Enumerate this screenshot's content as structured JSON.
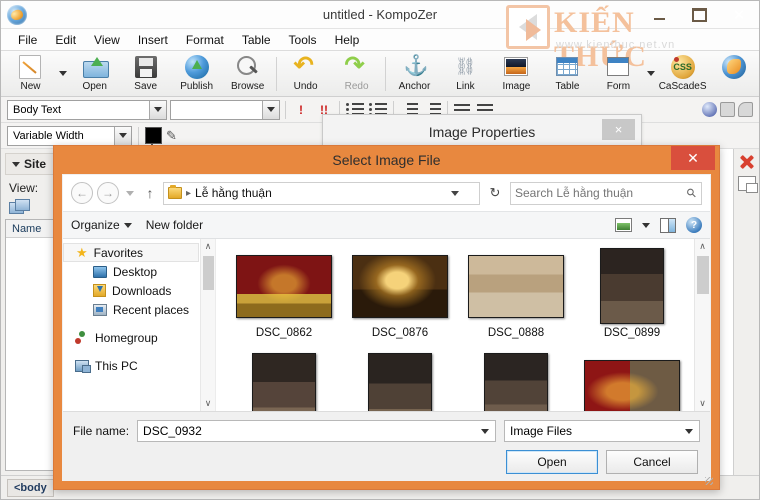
{
  "app": {
    "title": "untitled - KompoZer",
    "icon": "kompozer-globe-icon",
    "window_controls": {
      "minimize": "–",
      "maximize": "□",
      "close": "✕"
    }
  },
  "watermark": {
    "brand": "KIẾN THỨC",
    "url": "www.kienthuc.net.vn"
  },
  "menubar": [
    {
      "label": "File"
    },
    {
      "label": "Edit"
    },
    {
      "label": "View"
    },
    {
      "label": "Insert"
    },
    {
      "label": "Format"
    },
    {
      "label": "Table"
    },
    {
      "label": "Tools"
    },
    {
      "label": "Help"
    }
  ],
  "toolbar": [
    {
      "label": "New",
      "icon": "new-document-icon",
      "has_caret": true
    },
    {
      "label": "Open",
      "icon": "open-folder-icon",
      "has_caret": false
    },
    {
      "label": "Save",
      "icon": "save-floppy-icon",
      "has_caret": false
    },
    {
      "label": "Publish",
      "icon": "publish-globe-icon",
      "has_caret": false
    },
    {
      "label": "Browse",
      "icon": "browse-magnifier-icon",
      "has_caret": false
    },
    {
      "label": "Undo",
      "icon": "undo-arrow-icon",
      "has_caret": false
    },
    {
      "label": "Redo",
      "icon": "redo-arrow-icon",
      "has_caret": false
    },
    {
      "label": "Anchor",
      "icon": "anchor-icon",
      "has_caret": false
    },
    {
      "label": "Link",
      "icon": "link-chain-icon",
      "has_caret": false
    },
    {
      "label": "Image",
      "icon": "image-picture-icon",
      "has_caret": false
    },
    {
      "label": "Table",
      "icon": "table-grid-icon",
      "has_caret": false
    },
    {
      "label": "Form",
      "icon": "form-window-icon",
      "has_caret": true
    },
    {
      "label": "CaScadeS",
      "icon": "css-palette-icon",
      "has_caret": false
    },
    {
      "label": "",
      "icon": "firefox-globe-icon",
      "has_caret": false
    }
  ],
  "format_bar": {
    "paragraph_style": "Body Text",
    "font_family": "",
    "emphasis_label": "!",
    "strong_label": "!!"
  },
  "format_bar2": {
    "width_style": "Variable Width",
    "text_color": "#000000",
    "highlight_icon": "pencil-highlight-icon"
  },
  "side_panel": {
    "header": "Site",
    "view_label": "View:",
    "column_header": "Name"
  },
  "statusbar": {
    "tag": "<body"
  },
  "image_properties_dialog": {
    "title": "Image Properties",
    "close_label": "×"
  },
  "file_dialog": {
    "title": "Select Image File",
    "close_label": "✕",
    "nav": {
      "back": "←",
      "forward": "→",
      "history_caret": "▾",
      "up": "↑",
      "breadcrumb_folder": "Lễ hằng thuận",
      "breadcrumb_sep": "▸",
      "refresh": "↻",
      "search_placeholder": "Search Lễ hằng thuận",
      "search_value": ""
    },
    "command_bar": {
      "organize": "Organize",
      "new_folder": "New folder",
      "view_icon": "view-mode-icon",
      "pane_icon": "preview-pane-icon",
      "help_icon": "help-icon"
    },
    "tree": [
      {
        "label": "Favorites",
        "icon": "star-icon",
        "level": "root",
        "selected": true
      },
      {
        "label": "Desktop",
        "icon": "desktop-icon",
        "level": "child",
        "selected": false
      },
      {
        "label": "Downloads",
        "icon": "downloads-icon",
        "level": "child",
        "selected": false
      },
      {
        "label": "Recent places",
        "icon": "recent-places-icon",
        "level": "child",
        "selected": false
      },
      {
        "label": "Homegroup",
        "icon": "homegroup-icon",
        "level": "root",
        "selected": false
      },
      {
        "label": "This PC",
        "icon": "this-pc-icon",
        "level": "root",
        "selected": false
      }
    ],
    "files": [
      {
        "name": "DSC_0862",
        "orientation": "land",
        "pic": "pic1"
      },
      {
        "name": "DSC_0876",
        "orientation": "land",
        "pic": "pic2"
      },
      {
        "name": "DSC_0888",
        "orientation": "land",
        "pic": "pic3"
      },
      {
        "name": "DSC_0899",
        "orientation": "port",
        "pic": "pic4"
      },
      {
        "name": "",
        "orientation": "port",
        "pic": "pic5"
      },
      {
        "name": "",
        "orientation": "port",
        "pic": "pic6"
      },
      {
        "name": "",
        "orientation": "port",
        "pic": "pic7"
      },
      {
        "name": "",
        "orientation": "land",
        "pic": "pic8"
      }
    ],
    "footer": {
      "filename_label": "File name:",
      "filename_value": "DSC_0932",
      "filter_value": "Image Files",
      "open_button": "Open",
      "cancel_button": "Cancel"
    }
  },
  "colors": {
    "dialog_frame": "#e8883f",
    "dialog_close": "#d94f3d",
    "accent_blue": "#3b8fd4"
  }
}
